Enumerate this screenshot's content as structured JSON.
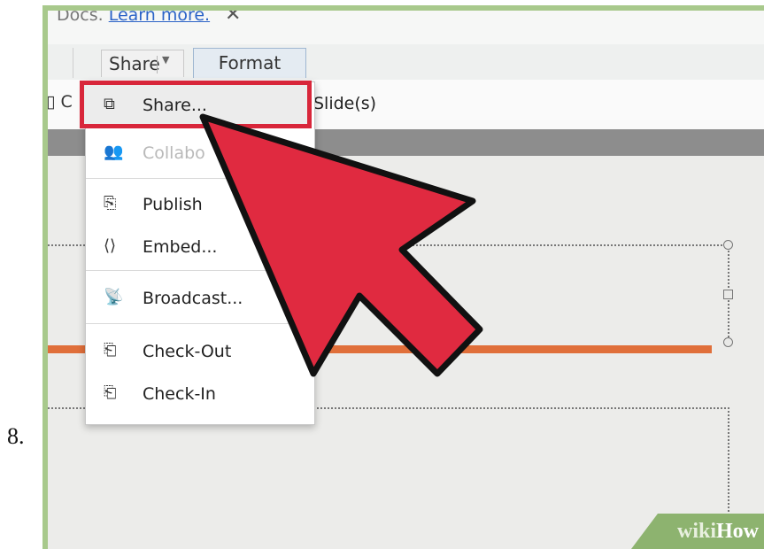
{
  "step": {
    "number": "8."
  },
  "infobar": {
    "prefix": "Docs.",
    "link": "Learn more.",
    "close_icon": "close-x-icon"
  },
  "toolbar": {
    "share_label": "Share",
    "format_label": "Format"
  },
  "ribbon": {
    "left_fragment": "C",
    "slides_label": "Slide(s)"
  },
  "share_menu": {
    "items": [
      {
        "label": "Share...",
        "icon": "share-icon",
        "enabled": true,
        "highlighted": true
      },
      {
        "label": "Collabo",
        "icon": "collaborate-icon",
        "enabled": false,
        "highlighted": false
      },
      {
        "label": "Publish",
        "icon": "publish-icon",
        "enabled": true,
        "highlighted": false
      },
      {
        "label": "Embed...",
        "icon": "embed-icon",
        "enabled": true,
        "highlighted": false
      },
      {
        "label": "Broadcast...",
        "icon": "broadcast-icon",
        "enabled": true,
        "highlighted": false
      },
      {
        "label": "Check-Out",
        "icon": "check-out-icon",
        "enabled": true,
        "highlighted": false
      },
      {
        "label": "Check-In",
        "icon": "check-in-icon",
        "enabled": true,
        "highlighted": false
      }
    ]
  },
  "colors": {
    "highlight": "#d8263a",
    "arrow_fill": "#e02a40",
    "accent_line": "#e06f3a",
    "frame": "#a8c98c"
  },
  "watermark": {
    "part1": "wiki",
    "part2": "How"
  }
}
